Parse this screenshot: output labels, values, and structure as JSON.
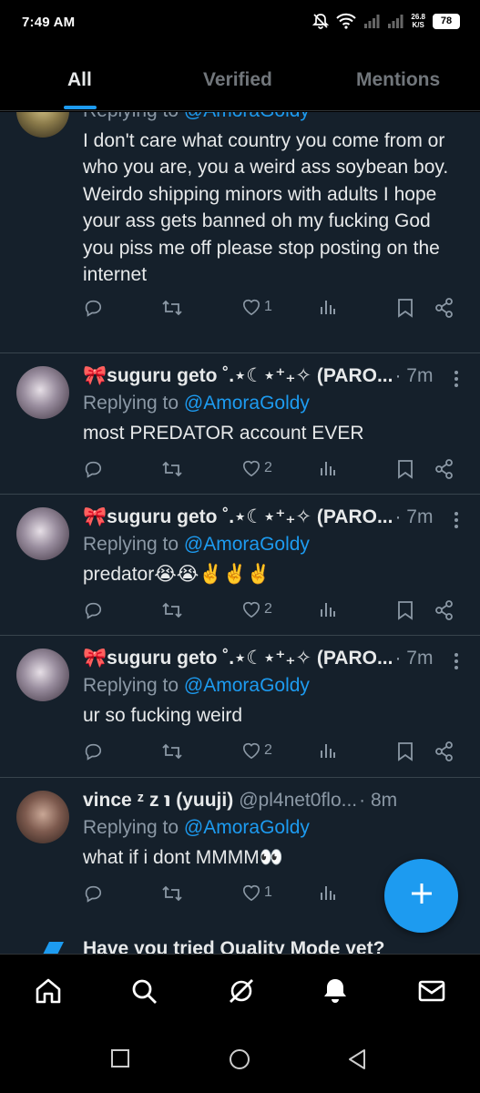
{
  "status_bar": {
    "time": "7:49 AM",
    "net_speed_value": "26.8",
    "net_speed_unit": "K/S",
    "battery": "78"
  },
  "tabs": [
    {
      "label": "All",
      "active": true
    },
    {
      "label": "Verified",
      "active": false
    },
    {
      "label": "Mentions",
      "active": false
    }
  ],
  "tweets": [
    {
      "name": "",
      "handle": "",
      "time": "",
      "replying_prefix": "Replying to",
      "replying_to": "@AmoraGoldy",
      "text": "I don't care what country you come from or who you are, you a weird ass soybean boy. Weirdo shipping minors with adults I hope your ass gets banned oh my fucking God you piss me off please stop posting on the internet",
      "likes": "1"
    },
    {
      "name": "🎀suguru geto ˚.⋆☾⋆⁺₊✧ (PARO...",
      "handle": "",
      "time": "· 7m",
      "replying_prefix": "Replying to",
      "replying_to": "@AmoraGoldy",
      "text": "most PREDATOR account EVER",
      "likes": "2"
    },
    {
      "name": "🎀suguru geto ˚.⋆☾⋆⁺₊✧ (PARO...",
      "handle": "",
      "time": "· 7m",
      "replying_prefix": "Replying to",
      "replying_to": "@AmoraGoldy",
      "text": "predator😭😭✌️✌️✌️",
      "likes": "2"
    },
    {
      "name": "🎀suguru geto ˚.⋆☾⋆⁺₊✧ (PARO...",
      "handle": "",
      "time": "· 7m",
      "replying_prefix": "Replying to",
      "replying_to": "@AmoraGoldy",
      "text": "ur so fucking weird",
      "likes": "2"
    },
    {
      "name": "vince ᶻ z ℩ (yuuji)",
      "handle": "@pl4net0flo...",
      "time": "· 8m",
      "replying_prefix": "Replying to",
      "replying_to": "@AmoraGoldy",
      "text": "what if i dont MMMM👀",
      "likes": "1"
    }
  ],
  "promo": {
    "text": "Have you tried Quality Mode yet?"
  },
  "icons": {
    "reply": "reply-icon",
    "retweet": "retweet-icon",
    "like": "heart-icon",
    "views": "views-icon",
    "bookmark": "bookmark-icon",
    "share": "share-icon",
    "compose": "plus-icon"
  },
  "colors": {
    "accent": "#1d9bf0",
    "background": "#15202b",
    "secondary_text": "#8b98a5"
  }
}
